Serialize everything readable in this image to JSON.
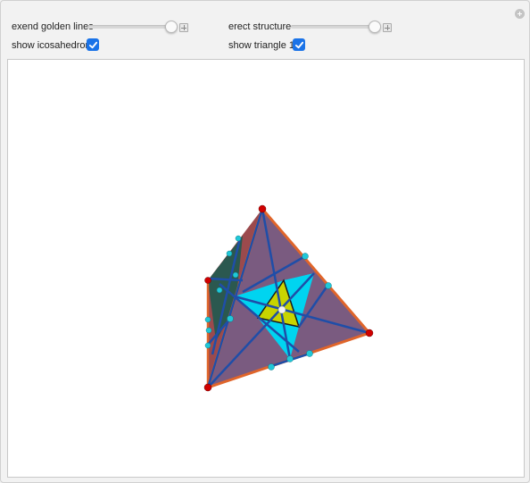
{
  "controls": {
    "slider1": {
      "label": "exend golden lines",
      "value": 1.0
    },
    "slider2": {
      "label": "erect structure",
      "value": 1.0
    },
    "checkbox1": {
      "label": "show icosahedron",
      "checked": true
    },
    "checkbox2": {
      "label": "show triangle 1",
      "checked": true
    }
  },
  "colors": {
    "accent": "#1a73e8",
    "face_purple": "#7b5a7e",
    "face_cyan": "#00d4f0",
    "face_yellow": "#c8d400",
    "edge_blue": "#1f4ea8",
    "edge_orange": "#e0652a",
    "vertex_red": "#d00000",
    "point_cyan": "#20c8d8"
  }
}
